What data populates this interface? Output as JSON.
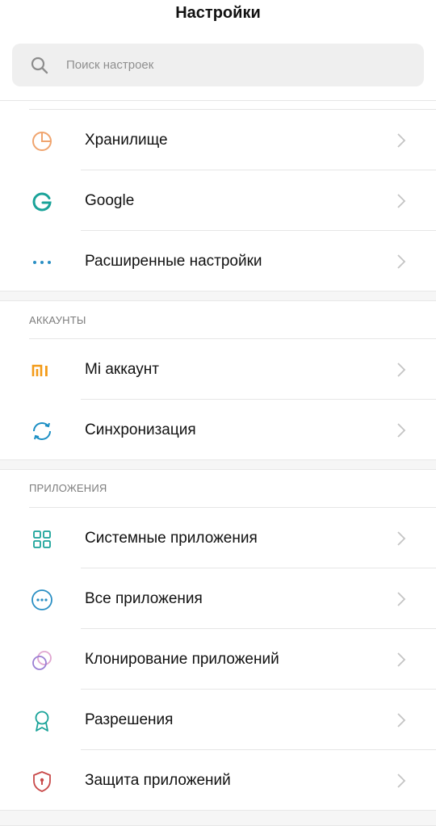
{
  "header": {
    "title": "Настройки"
  },
  "search": {
    "placeholder": "Поиск настроек"
  },
  "colors": {
    "orange": "#f0a46e",
    "teal": "#1aa399",
    "mi": "#f39b18",
    "purple": "#b08ad6",
    "red": "#c94a4a",
    "chevron": "#c4c4c4"
  },
  "system": {
    "items": [
      {
        "label": "Хранилище",
        "icon": "storage-pie-icon"
      },
      {
        "label": "Google",
        "icon": "google-g-icon"
      },
      {
        "label": "Расширенные настройки",
        "icon": "more-dots-icon"
      }
    ]
  },
  "accounts": {
    "title": "АККАУНТЫ",
    "items": [
      {
        "label": "Mi аккаунт",
        "icon": "mi-logo-icon"
      },
      {
        "label": "Синхронизация",
        "icon": "sync-icon"
      }
    ]
  },
  "apps": {
    "title": "ПРИЛОЖЕНИЯ",
    "items": [
      {
        "label": "Системные приложения",
        "icon": "grid-apps-icon"
      },
      {
        "label": "Все приложения",
        "icon": "all-apps-icon"
      },
      {
        "label": "Клонирование приложений",
        "icon": "clone-circles-icon"
      },
      {
        "label": "Разрешения",
        "icon": "permissions-badge-icon"
      },
      {
        "label": "Защита приложений",
        "icon": "shield-lock-icon"
      }
    ]
  }
}
